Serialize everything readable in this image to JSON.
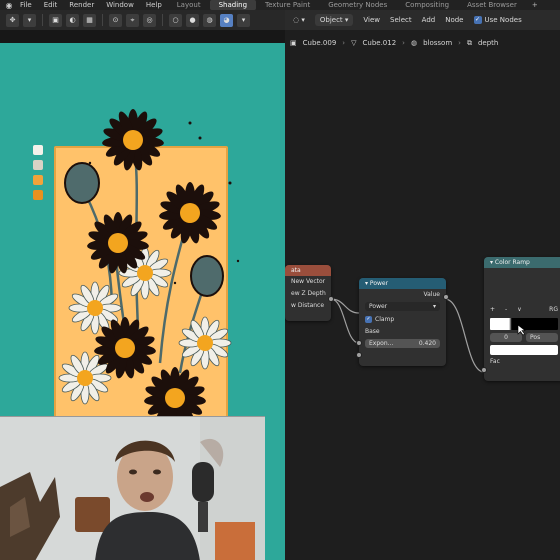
{
  "menubar": {
    "items": [
      "File",
      "Edit",
      "Render",
      "Window",
      "Help"
    ],
    "workspaces": [
      "Layout",
      "Shading",
      "Texture Paint",
      "Geometry Nodes",
      "Compositing",
      "Asset Browser"
    ],
    "active_workspace": "Shading",
    "plus": "+"
  },
  "node_header": {
    "mode": "Object",
    "view": "View",
    "select": "Select",
    "add": "Add",
    "node": "Node",
    "use_nodes": "Use Nodes"
  },
  "breadcrumb": [
    "Cube.009",
    "Cube.012",
    "blossom",
    "depth"
  ],
  "colors": {
    "teal": "#2da89a",
    "card": "#ffc26a",
    "swatches": [
      "#f4f1ea",
      "#d8d2c5",
      "#f2a33a",
      "#e8911f"
    ]
  },
  "nodes": {
    "geometry_partial": {
      "title": "ata",
      "outputs": [
        "New Vector",
        "ew Z Depth",
        "w Distance"
      ]
    },
    "power": {
      "title": "Power",
      "output": "Value",
      "operation": "Power",
      "clamp": "Clamp",
      "input_base": "Base",
      "exponent_label": "Expon...",
      "exponent_value": "0.420"
    },
    "color_ramp": {
      "title": "Color Ramp",
      "buttons": [
        "+",
        "-",
        "∨"
      ],
      "mode": "RG",
      "stop_index": "0",
      "position_label": "Pos",
      "input_fac": "Fac"
    }
  }
}
